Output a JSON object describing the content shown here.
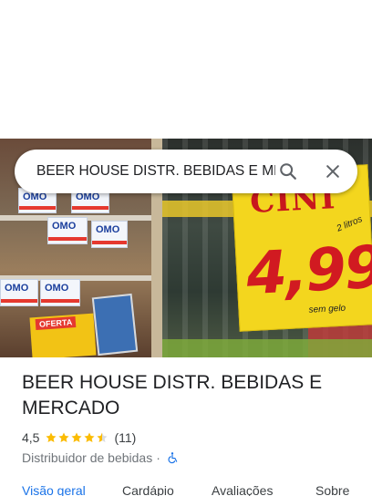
{
  "search": {
    "value": "BEER HOUSE DISTR. BEBIDAS E MERCADO",
    "search_icon": "search-icon",
    "close_icon": "close-icon"
  },
  "photo": {
    "left_brand": "OMO",
    "oferta_label": "OFERTA",
    "price_sign_brand": "CINI",
    "price_sign_volume": "2 litros",
    "price_sign_price": "4,99",
    "price_sign_note": "sem gelo"
  },
  "place": {
    "title": "BEER HOUSE DISTR. BEBIDAS E MERCADO",
    "rating": "4,5",
    "stars": 4.5,
    "review_count": "(11)",
    "category": "Distribuidor de bebidas",
    "separator": "·",
    "accessibility_icon": "wheelchair-icon"
  },
  "tabs": [
    {
      "label": "Visão geral",
      "active": true
    },
    {
      "label": "Cardápio",
      "active": false
    },
    {
      "label": "Avaliações",
      "active": false
    },
    {
      "label": "Sobre",
      "active": false
    }
  ],
  "colors": {
    "accent_blue": "#1a73e8",
    "star_gold": "#fbbc04",
    "text_primary": "#202124",
    "text_secondary": "#70757a"
  }
}
